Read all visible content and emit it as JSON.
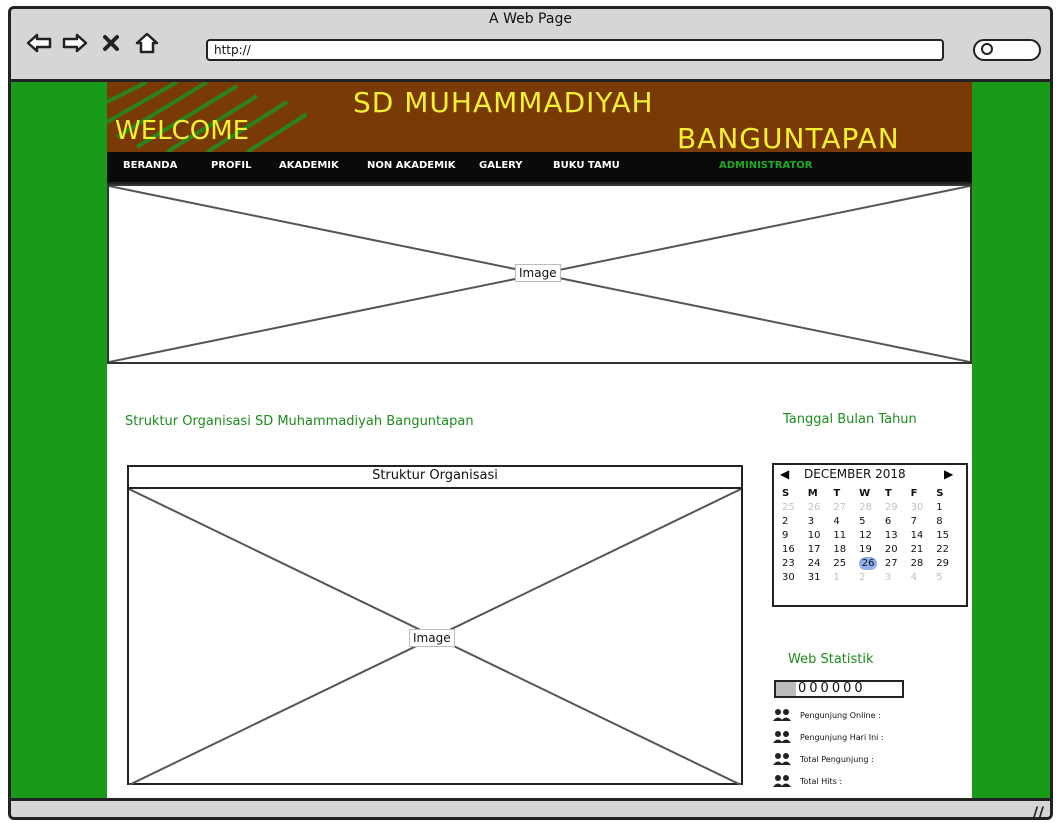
{
  "window": {
    "title": "A Web Page",
    "url": "http://"
  },
  "header": {
    "school_line1": "SD MUHAMMADIYAH",
    "welcome": "WELCOME",
    "school_line2": "BANGUNTAPAN"
  },
  "menu": {
    "items": [
      "BERANDA",
      "PROFIL",
      "AKADEMIK",
      "NON AKADEMIK",
      "GALERY",
      "BUKU TAMU"
    ],
    "admin": "ADMINISTRATOR"
  },
  "banner": {
    "image_label": "Image"
  },
  "main": {
    "section_title": "Struktur Organisasi SD Muhammadiyah Banguntapan",
    "org_title": "Struktur Organisasi",
    "org_image_label": "Image"
  },
  "sidebar": {
    "date_title": "Tanggal Bulan Tahun",
    "calendar": {
      "month_label": "DECEMBER 2018",
      "weekday_labels": [
        "S",
        "M",
        "T",
        "W",
        "T",
        "F",
        "S"
      ],
      "weeks": [
        [
          "25",
          "26",
          "27",
          "28",
          "29",
          "30",
          "1"
        ],
        [
          "2",
          "3",
          "4",
          "5",
          "6",
          "7",
          "8"
        ],
        [
          "9",
          "10",
          "11",
          "12",
          "13",
          "14",
          "15"
        ],
        [
          "16",
          "17",
          "18",
          "19",
          "20",
          "21",
          "22"
        ],
        [
          "23",
          "24",
          "25",
          "26",
          "27",
          "28",
          "29"
        ],
        [
          "30",
          "31",
          "1",
          "2",
          "3",
          "4",
          "5"
        ]
      ],
      "selected_day": "26"
    },
    "stats_title": "Web Statistik",
    "counter": "000000",
    "stats": [
      {
        "label": "Pengunjung Online :"
      },
      {
        "label": "Pengunjung Hari Ini :"
      },
      {
        "label": "Total Pengunjung :"
      },
      {
        "label": "Total Hits :"
      }
    ]
  },
  "colors": {
    "background_green": "#1a9a1a",
    "header_brown": "#7a3a06",
    "header_text_yellow": "#f3f032",
    "accent_green_text": "#1c8c1c",
    "calendar_selected": "#8fb0ea"
  }
}
